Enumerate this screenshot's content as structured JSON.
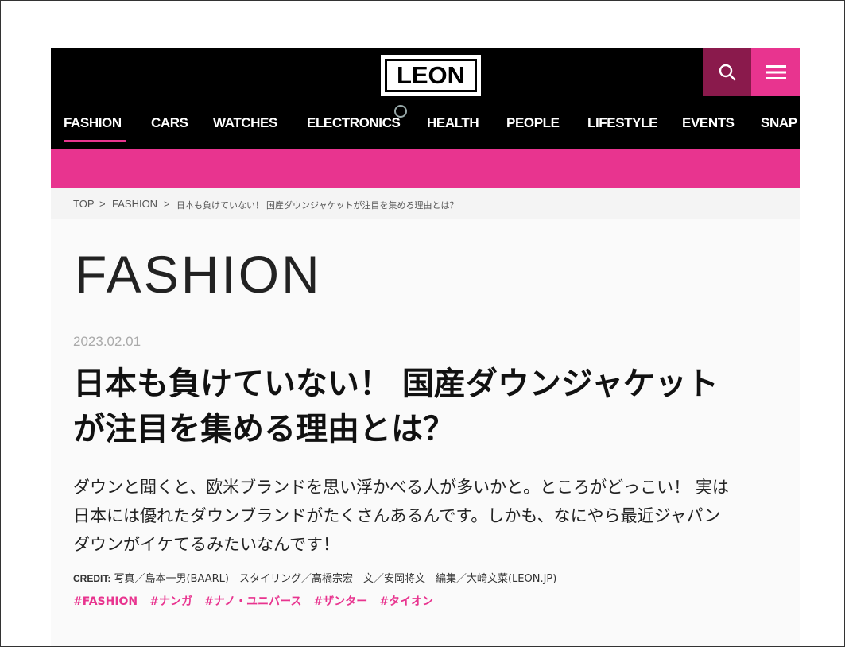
{
  "header": {
    "logo": "LEON",
    "search_icon": "search-icon",
    "menu_icon": "hamburger-menu-icon",
    "colors": {
      "bar": "#000000",
      "accent": "#e8348f",
      "search_bg": "#8a1a4c"
    }
  },
  "nav": {
    "items": [
      {
        "label": "FASHION"
      },
      {
        "label": "CARS"
      },
      {
        "label": "WATCHES"
      },
      {
        "label": "ELECTRONICS"
      },
      {
        "label": "HEALTH"
      },
      {
        "label": "PEOPLE"
      },
      {
        "label": "LIFESTYLE"
      },
      {
        "label": "EVENTS"
      },
      {
        "label": "SNAP"
      }
    ],
    "active": "FASHION"
  },
  "breadcrumb": {
    "items": [
      "TOP",
      "FASHION",
      "日本も負けていない！ 国産ダウンジャケットが注目を集める理由とは？"
    ],
    "separator": ">"
  },
  "article": {
    "section": "FASHION",
    "date": "2023.02.01",
    "title_line1": "日本も負けていない！ 国産ダウンジャケット",
    "title_line2": "が注目を集める理由とは？",
    "lede_line1": "ダウンと聞くと、欧米ブランドを思い浮かべる人が多いかと。ところがどっこい！ 実は",
    "lede_line2": "日本には優れたダウンブランドがたくさんあるんです。しかも、なにやら最近ジャパン",
    "lede_line3": "ダウンがイケてるみたいなんです！",
    "credit_label": "CREDIT:",
    "credit_text": "写真／島本一男(BAARL)　スタイリング／高橋宗宏　文／安岡将文　編集／大崎文菜(LEON.JP)",
    "tags": [
      "#FASHION",
      "#ナンガ",
      "#ナノ・ユニバース",
      "#ザンター",
      "#タイオン"
    ]
  }
}
